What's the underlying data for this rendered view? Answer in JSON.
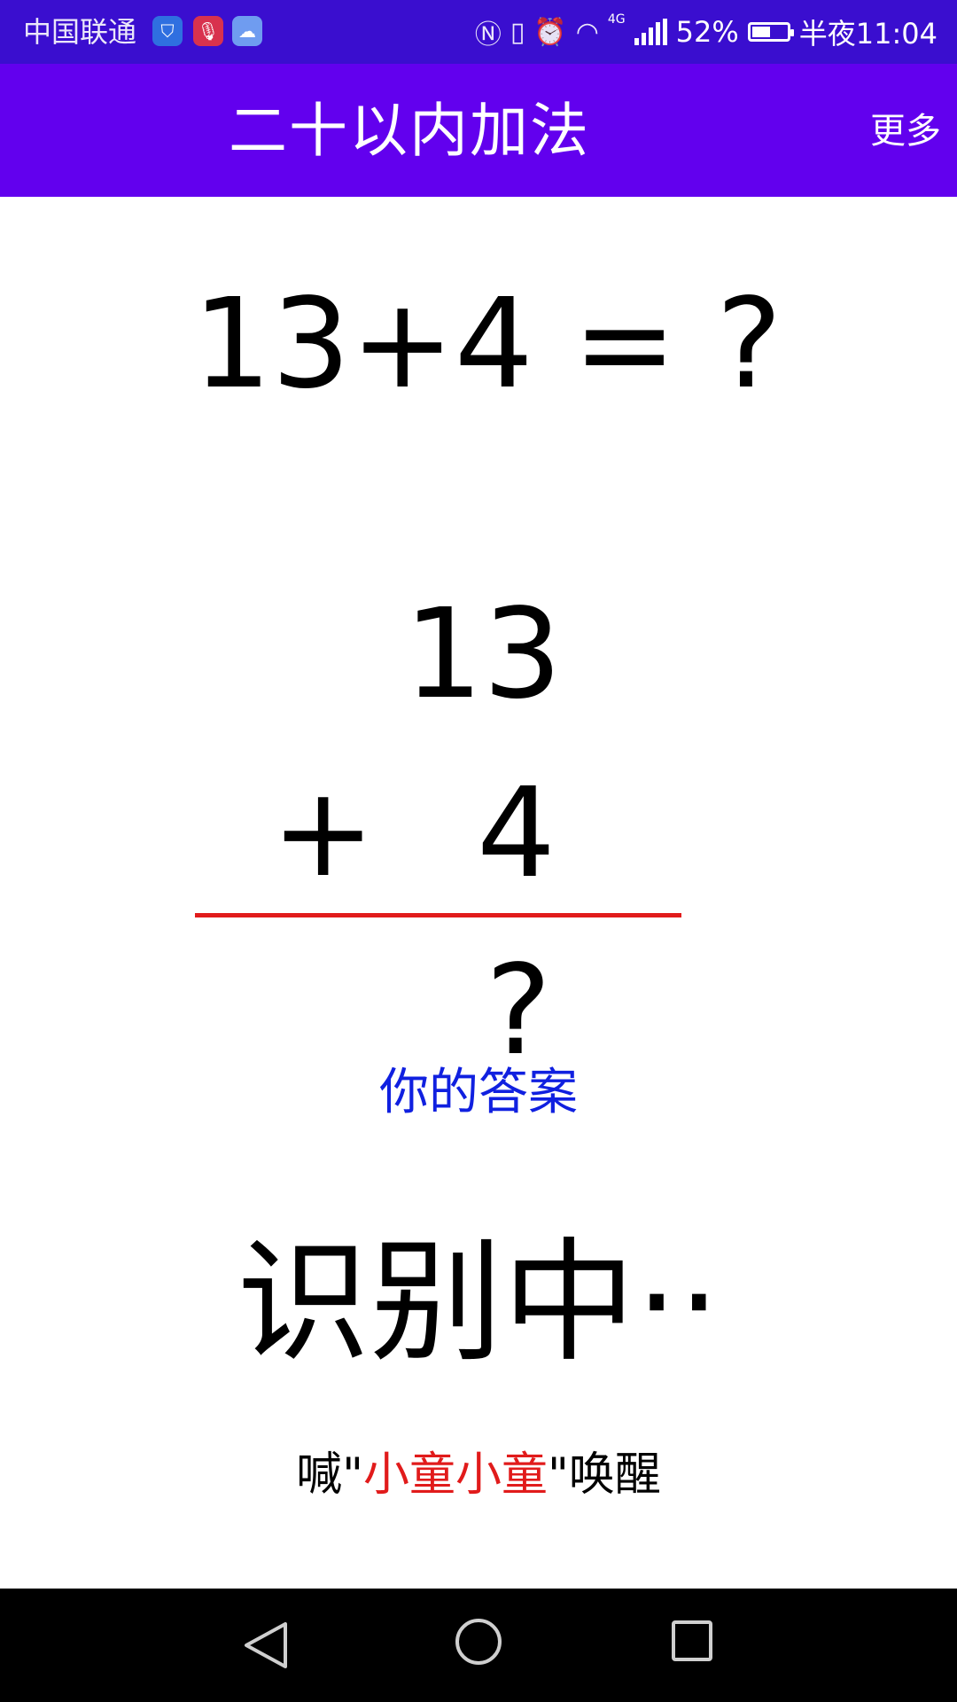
{
  "status_bar": {
    "carrier": "中国联通",
    "battery_percent": "52%",
    "battery_level": 0.52,
    "time": "半夜11:04",
    "network": "4G",
    "icons": [
      "shield-icon",
      "microphone-icon",
      "cloud-app-icon",
      "nfc-icon",
      "vibrate-icon",
      "alarm-icon",
      "wifi-icon",
      "signal-icon",
      "battery-icon"
    ]
  },
  "app_bar": {
    "title": "二十以内加法",
    "more_label": "更多"
  },
  "problem": {
    "equation": "13+4 = ?",
    "top_number": "13",
    "operator": "+",
    "bottom_number": "4",
    "answer_placeholder": "?",
    "answer_label": "你的答案"
  },
  "status": {
    "recognizing": "识别中··"
  },
  "wake_hint": {
    "prefix": "喊\"",
    "keyword": "小童小童",
    "suffix": "\"唤醒"
  },
  "colors": {
    "status_bar_bg": "#3a0ecf",
    "app_bar_bg": "#6200ee",
    "divider_red": "#e11b1b",
    "answer_label_blue": "#1020e0"
  }
}
